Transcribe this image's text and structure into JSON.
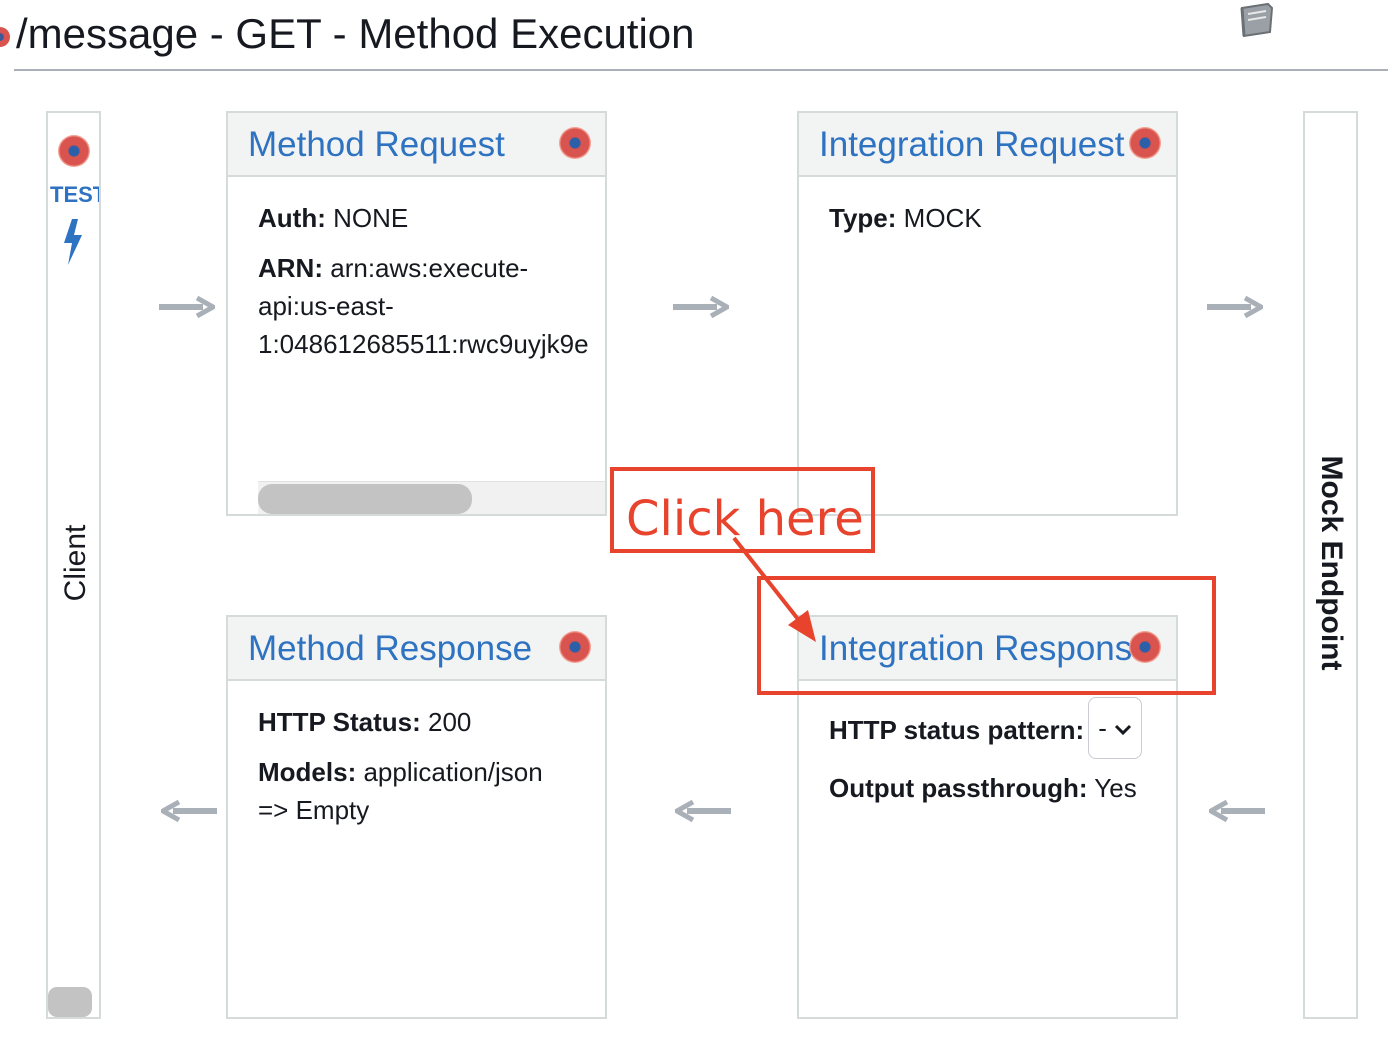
{
  "header": {
    "title": "/message - GET - Method Execution"
  },
  "client": {
    "test_label": "TEST",
    "label": "Client"
  },
  "endpoint": {
    "label": "Mock Endpoint"
  },
  "method_request": {
    "title": "Method Request",
    "auth_label": "Auth:",
    "auth_value": "NONE",
    "arn_label": "ARN:",
    "arn_line1": "arn:aws:execute-",
    "arn_line2": "api:us-east-",
    "arn_line3": "1:048612685511:rwc9uyjk9e"
  },
  "integration_request": {
    "title": "Integration Request",
    "type_label": "Type:",
    "type_value": "MOCK"
  },
  "method_response": {
    "title": "Method Response",
    "status_label": "HTTP Status:",
    "status_value": "200",
    "models_label": "Models:",
    "models_value_line1": "application/json",
    "models_value_line2": "=> Empty"
  },
  "integration_response": {
    "title": "Integration Response",
    "pattern_label": "HTTP status pattern:",
    "pattern_value": "-",
    "passthrough_label": "Output passthrough:",
    "passthrough_value": "Yes"
  },
  "annotation": {
    "callout_text": "Click here",
    "color": "#e8432d"
  },
  "colors": {
    "link_blue": "#2e72c2",
    "border": "#d5dbdb",
    "header_fill": "#f2f3f3",
    "arrow_gray": "#aab0b8"
  }
}
